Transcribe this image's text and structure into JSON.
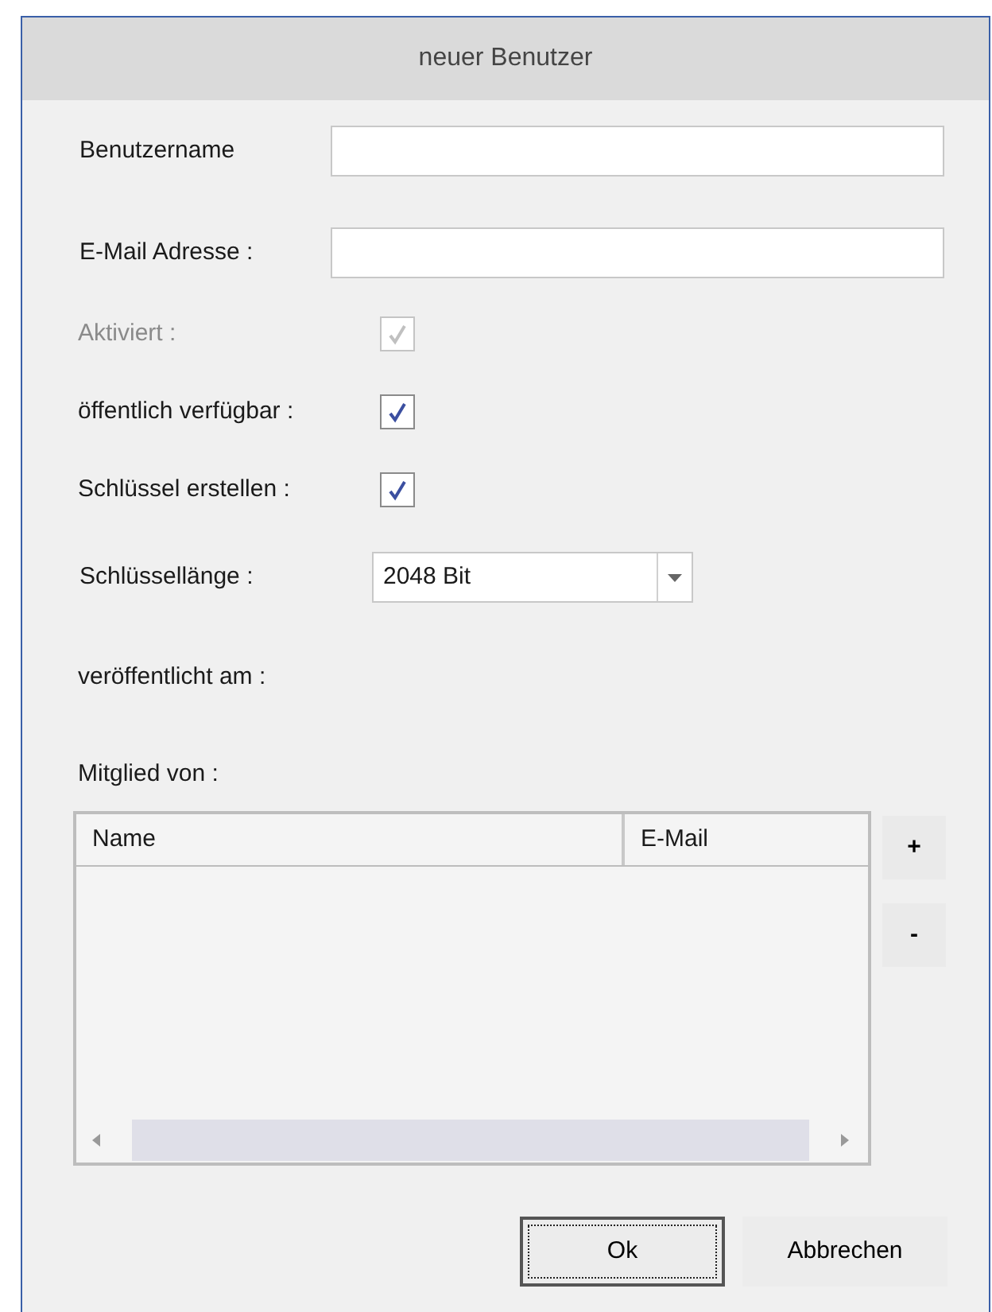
{
  "window": {
    "title": "neuer Benutzer"
  },
  "fields": [
    {
      "label": "Benutzername"
    },
    {
      "label": "E-Mail Adresse :"
    }
  ],
  "checkboxes": [
    {
      "label": "Aktiviert :",
      "checked": true,
      "disabled": true
    },
    {
      "label": "öffentlich verfügbar :",
      "checked": true,
      "disabled": false
    },
    {
      "label": "Schlüssel erstellen :",
      "checked": true,
      "disabled": false
    }
  ],
  "key_length": {
    "label": "Schlüssellänge :",
    "value": "2048 Bit"
  },
  "published": {
    "label": "veröffentlicht am :"
  },
  "members": {
    "label": "Mitglied von :",
    "columns": [
      "Name",
      "E-Mail"
    ],
    "buttons": [
      "+",
      "-"
    ]
  },
  "buttons": [
    {
      "label": "Ok",
      "default": true
    },
    {
      "label": "Abbrechen",
      "default": false
    }
  ]
}
